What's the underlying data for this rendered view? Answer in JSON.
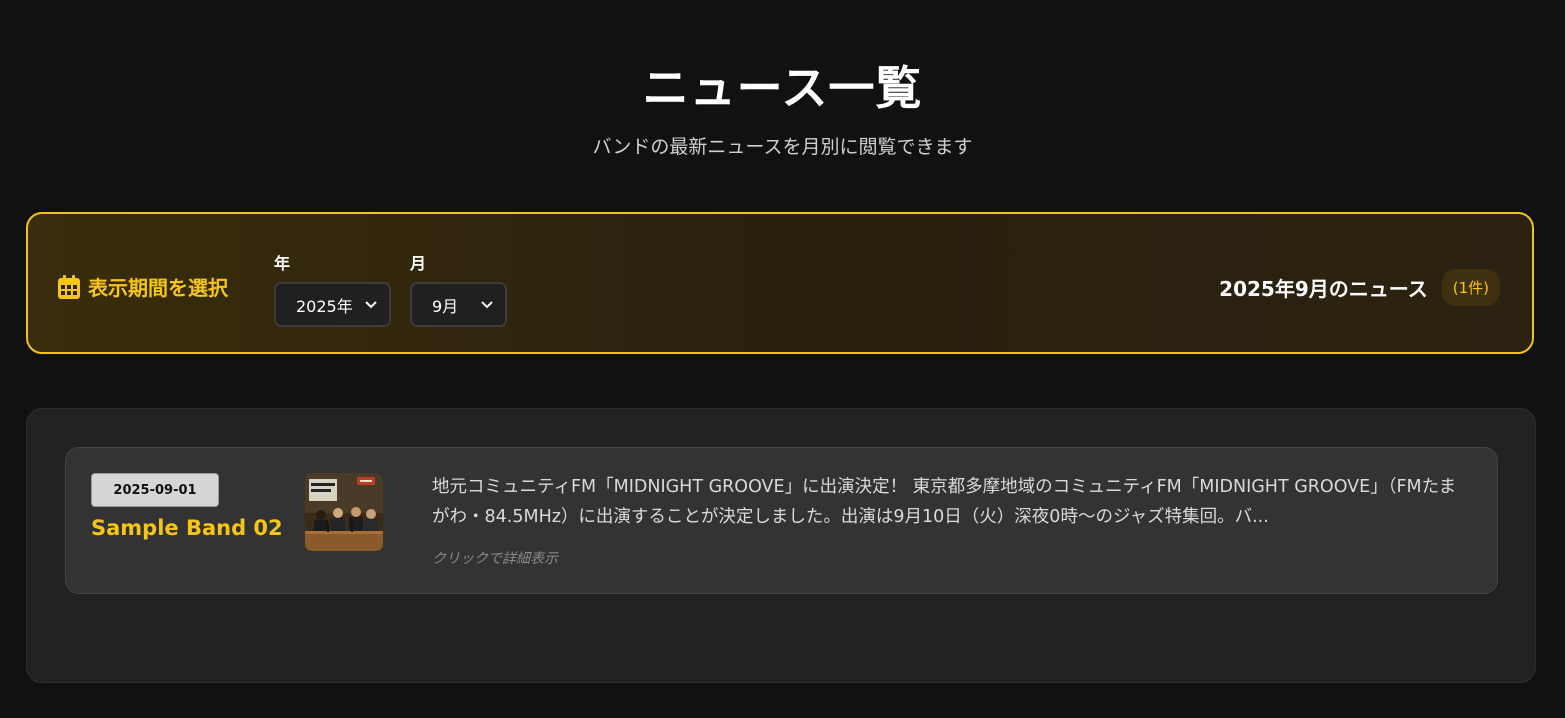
{
  "header": {
    "title": "ニュース一覧",
    "subtitle": "バンドの最新ニュースを月別に閲覧できます"
  },
  "filter": {
    "label": "表示期間を選択",
    "icon": "calendar-icon",
    "year": {
      "label": "年",
      "selected": "2025年"
    },
    "month": {
      "label": "月",
      "selected": "9月"
    },
    "result_title": "2025年9月のニュース",
    "count": "(1件)"
  },
  "news": {
    "items": [
      {
        "date": "2025-09-01",
        "band": "Sample Band 02",
        "thumbnail": "radio-studio-photo",
        "text": "地元コミュニティFM「MIDNIGHT GROOVE」に出演決定！ 東京都多摩地域のコミュニティFM「MIDNIGHT GROOVE」（FMたまがわ・84.5MHz）に出演することが決定しました。出演は9月10日（火）深夜0時〜のジャズ特集回。バ...",
        "hint": "クリックで詳細表示"
      }
    ]
  },
  "colors": {
    "background": "#111111",
    "accent": "#f5c518",
    "panel": "#222222",
    "card": "#333333"
  }
}
